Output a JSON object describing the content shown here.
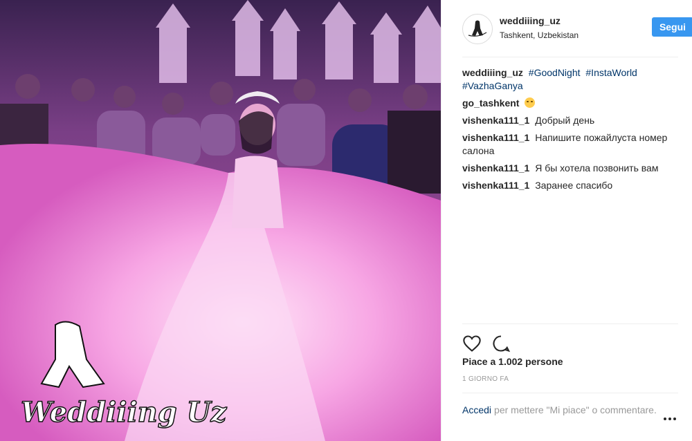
{
  "post": {
    "username": "weddiiing_uz",
    "location": "Tashkent, Uzbekistan",
    "follow_label": "Segui",
    "avatar_icon": "wedding-logo-icon",
    "watermark_text": "Weddiiing Uz",
    "caption": {
      "user": "weddiiing_uz",
      "tags": [
        "#GoodNight",
        "#InstaWorld",
        "#VazhaGanya"
      ]
    },
    "comments": [
      {
        "user": "go_tashkent",
        "text": ""
      },
      {
        "user": "vishenka111_1",
        "text": "Добрый день"
      },
      {
        "user": "vishenka111_1",
        "text": "Напишите пожайлуста номер салона"
      },
      {
        "user": "vishenka111_1",
        "text": "Я бы хотела позвонить вам"
      },
      {
        "user": "vishenka111_1",
        "text": "Заранее спасибо"
      }
    ],
    "likes_text": "Piace a 1.002 persone",
    "time_text": "1 GIORNO FA",
    "login_link": "Accedi",
    "login_text": "per mettere \"Mi piace\" o commentare.",
    "icons": {
      "like": "heart-icon",
      "comment": "comment-bubble-icon",
      "more": "more-options-icon"
    },
    "colors": {
      "accent": "#3897f0",
      "hashtag": "#003569",
      "muted": "#999999",
      "photo_tint": "#c64aa8"
    }
  }
}
